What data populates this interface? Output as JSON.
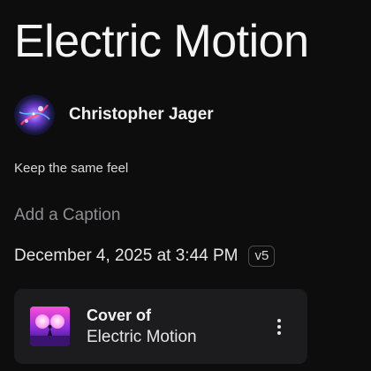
{
  "song": {
    "title": "Electric Motion"
  },
  "author": {
    "name": "Christopher Jager",
    "avatar_icon": "nebula-avatar"
  },
  "description": "Keep the same feel",
  "caption": {
    "placeholder": "Add a Caption"
  },
  "meta": {
    "date": "December 4, 2025 at 3:44 PM",
    "version": "v5"
  },
  "cover": {
    "line1": "Cover of",
    "line2": "Electric Motion",
    "thumb_icon": "neon-moon-artwork",
    "more_icon": "vertical-ellipsis"
  },
  "colors": {
    "background": "#0d0d0e",
    "card": "#1c1c1e",
    "caption_placeholder": "#8e8e93"
  }
}
